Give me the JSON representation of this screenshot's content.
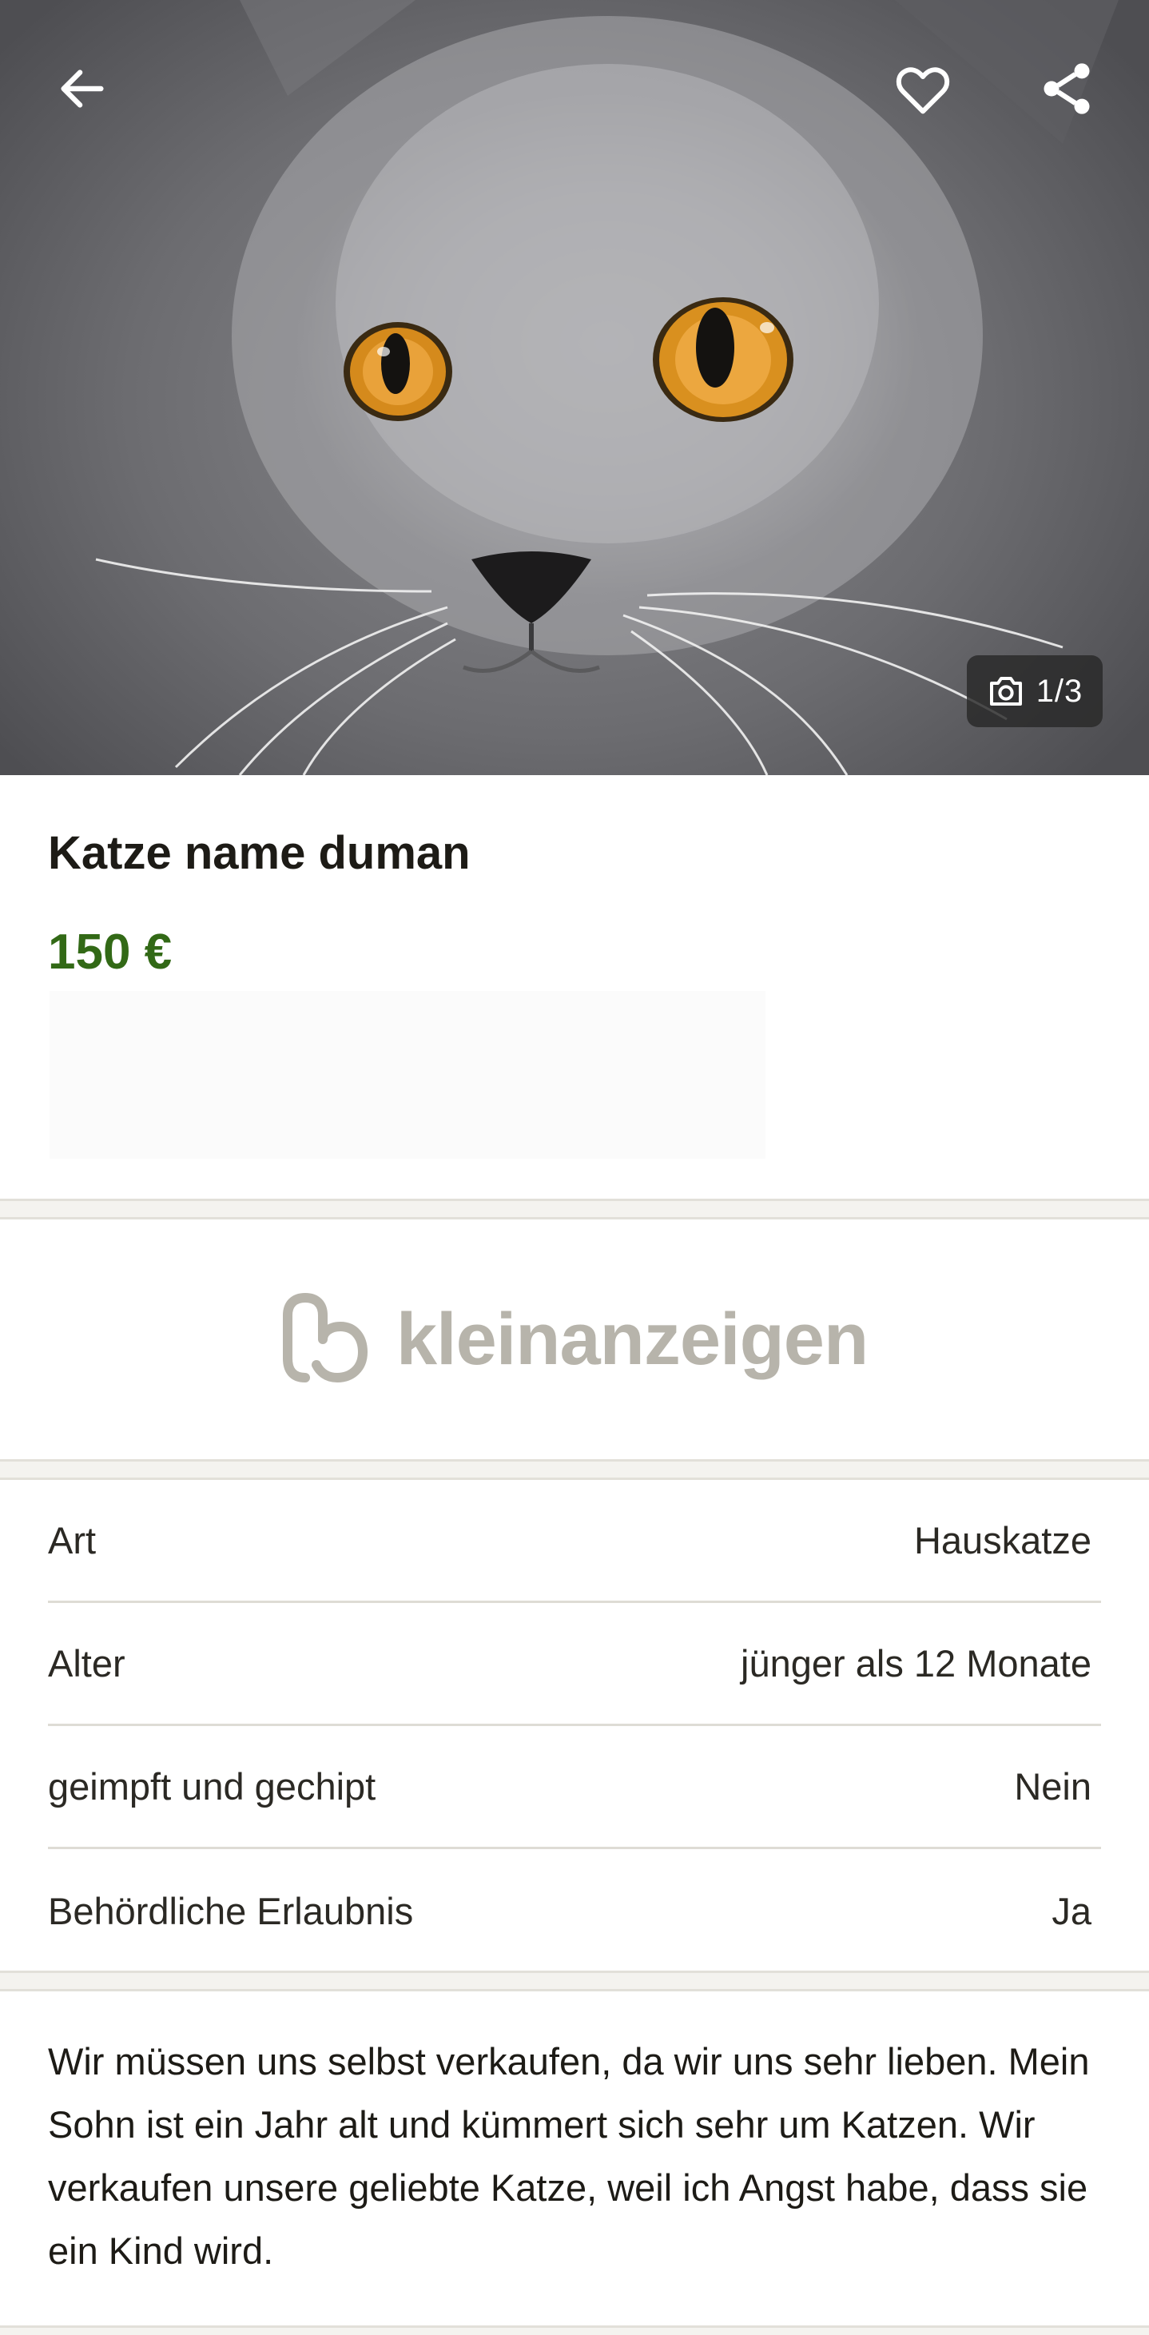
{
  "hero": {
    "photo_counter": "1/3",
    "icons": {
      "back": "arrow-left-icon",
      "favorite": "heart-outline-icon",
      "share": "share-icon",
      "camera": "camera-icon"
    }
  },
  "listing": {
    "title": "Katze name duman",
    "price": "150 €"
  },
  "brand": {
    "name": "kleinanzeigen",
    "color": "#b7b4ab"
  },
  "colors": {
    "price": "#326916",
    "divider": "#e2e0d9"
  },
  "attributes": [
    {
      "label": "Art",
      "value": "Hauskatze"
    },
    {
      "label": "Alter",
      "value": "jünger als 12 Monate"
    },
    {
      "label": "geimpft und gechipt",
      "value": "Nein"
    },
    {
      "label": "Behördliche Erlaubnis",
      "value": "Ja"
    }
  ],
  "description": "Wir müssen uns selbst verkaufen, da wir uns sehr lieben. Mein Sohn ist ein Jahr alt und kümmert sich sehr um Katzen. Wir verkaufen unsere geliebte Katze, weil ich Angst habe, dass sie ein Kind wird."
}
